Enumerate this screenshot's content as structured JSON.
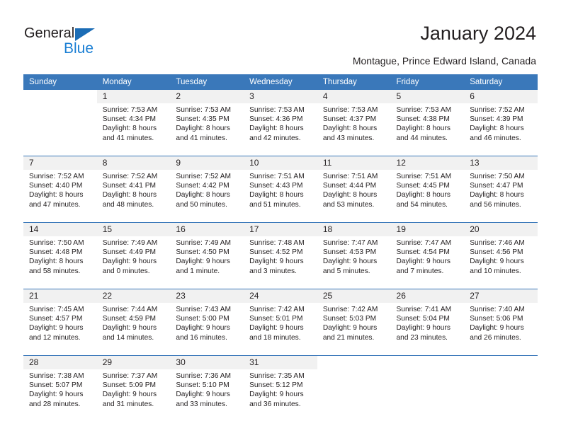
{
  "logo": {
    "word_general": "General",
    "word_blue": "Blue",
    "triangle_color": "#1b6cb5",
    "blue_text_color": "#1b7fd4"
  },
  "header": {
    "title": "January 2024",
    "subtitle": "Montague, Prince Edward Island, Canada"
  },
  "calendar": {
    "accent_color": "#3a78ba",
    "daynum_bg": "#f1f1f1",
    "weekday_headers": [
      "Sunday",
      "Monday",
      "Tuesday",
      "Wednesday",
      "Thursday",
      "Friday",
      "Saturday"
    ],
    "weeks": [
      {
        "days": [
          {
            "num": "",
            "sunrise": "",
            "sunset": "",
            "daylight_1": "",
            "daylight_2": ""
          },
          {
            "num": "1",
            "sunrise": "Sunrise: 7:53 AM",
            "sunset": "Sunset: 4:34 PM",
            "daylight_1": "Daylight: 8 hours",
            "daylight_2": "and 41 minutes."
          },
          {
            "num": "2",
            "sunrise": "Sunrise: 7:53 AM",
            "sunset": "Sunset: 4:35 PM",
            "daylight_1": "Daylight: 8 hours",
            "daylight_2": "and 41 minutes."
          },
          {
            "num": "3",
            "sunrise": "Sunrise: 7:53 AM",
            "sunset": "Sunset: 4:36 PM",
            "daylight_1": "Daylight: 8 hours",
            "daylight_2": "and 42 minutes."
          },
          {
            "num": "4",
            "sunrise": "Sunrise: 7:53 AM",
            "sunset": "Sunset: 4:37 PM",
            "daylight_1": "Daylight: 8 hours",
            "daylight_2": "and 43 minutes."
          },
          {
            "num": "5",
            "sunrise": "Sunrise: 7:53 AM",
            "sunset": "Sunset: 4:38 PM",
            "daylight_1": "Daylight: 8 hours",
            "daylight_2": "and 44 minutes."
          },
          {
            "num": "6",
            "sunrise": "Sunrise: 7:52 AM",
            "sunset": "Sunset: 4:39 PM",
            "daylight_1": "Daylight: 8 hours",
            "daylight_2": "and 46 minutes."
          }
        ]
      },
      {
        "days": [
          {
            "num": "7",
            "sunrise": "Sunrise: 7:52 AM",
            "sunset": "Sunset: 4:40 PM",
            "daylight_1": "Daylight: 8 hours",
            "daylight_2": "and 47 minutes."
          },
          {
            "num": "8",
            "sunrise": "Sunrise: 7:52 AM",
            "sunset": "Sunset: 4:41 PM",
            "daylight_1": "Daylight: 8 hours",
            "daylight_2": "and 48 minutes."
          },
          {
            "num": "9",
            "sunrise": "Sunrise: 7:52 AM",
            "sunset": "Sunset: 4:42 PM",
            "daylight_1": "Daylight: 8 hours",
            "daylight_2": "and 50 minutes."
          },
          {
            "num": "10",
            "sunrise": "Sunrise: 7:51 AM",
            "sunset": "Sunset: 4:43 PM",
            "daylight_1": "Daylight: 8 hours",
            "daylight_2": "and 51 minutes."
          },
          {
            "num": "11",
            "sunrise": "Sunrise: 7:51 AM",
            "sunset": "Sunset: 4:44 PM",
            "daylight_1": "Daylight: 8 hours",
            "daylight_2": "and 53 minutes."
          },
          {
            "num": "12",
            "sunrise": "Sunrise: 7:51 AM",
            "sunset": "Sunset: 4:45 PM",
            "daylight_1": "Daylight: 8 hours",
            "daylight_2": "and 54 minutes."
          },
          {
            "num": "13",
            "sunrise": "Sunrise: 7:50 AM",
            "sunset": "Sunset: 4:47 PM",
            "daylight_1": "Daylight: 8 hours",
            "daylight_2": "and 56 minutes."
          }
        ]
      },
      {
        "days": [
          {
            "num": "14",
            "sunrise": "Sunrise: 7:50 AM",
            "sunset": "Sunset: 4:48 PM",
            "daylight_1": "Daylight: 8 hours",
            "daylight_2": "and 58 minutes."
          },
          {
            "num": "15",
            "sunrise": "Sunrise: 7:49 AM",
            "sunset": "Sunset: 4:49 PM",
            "daylight_1": "Daylight: 9 hours",
            "daylight_2": "and 0 minutes."
          },
          {
            "num": "16",
            "sunrise": "Sunrise: 7:49 AM",
            "sunset": "Sunset: 4:50 PM",
            "daylight_1": "Daylight: 9 hours",
            "daylight_2": "and 1 minute."
          },
          {
            "num": "17",
            "sunrise": "Sunrise: 7:48 AM",
            "sunset": "Sunset: 4:52 PM",
            "daylight_1": "Daylight: 9 hours",
            "daylight_2": "and 3 minutes."
          },
          {
            "num": "18",
            "sunrise": "Sunrise: 7:47 AM",
            "sunset": "Sunset: 4:53 PM",
            "daylight_1": "Daylight: 9 hours",
            "daylight_2": "and 5 minutes."
          },
          {
            "num": "19",
            "sunrise": "Sunrise: 7:47 AM",
            "sunset": "Sunset: 4:54 PM",
            "daylight_1": "Daylight: 9 hours",
            "daylight_2": "and 7 minutes."
          },
          {
            "num": "20",
            "sunrise": "Sunrise: 7:46 AM",
            "sunset": "Sunset: 4:56 PM",
            "daylight_1": "Daylight: 9 hours",
            "daylight_2": "and 10 minutes."
          }
        ]
      },
      {
        "days": [
          {
            "num": "21",
            "sunrise": "Sunrise: 7:45 AM",
            "sunset": "Sunset: 4:57 PM",
            "daylight_1": "Daylight: 9 hours",
            "daylight_2": "and 12 minutes."
          },
          {
            "num": "22",
            "sunrise": "Sunrise: 7:44 AM",
            "sunset": "Sunset: 4:59 PM",
            "daylight_1": "Daylight: 9 hours",
            "daylight_2": "and 14 minutes."
          },
          {
            "num": "23",
            "sunrise": "Sunrise: 7:43 AM",
            "sunset": "Sunset: 5:00 PM",
            "daylight_1": "Daylight: 9 hours",
            "daylight_2": "and 16 minutes."
          },
          {
            "num": "24",
            "sunrise": "Sunrise: 7:42 AM",
            "sunset": "Sunset: 5:01 PM",
            "daylight_1": "Daylight: 9 hours",
            "daylight_2": "and 18 minutes."
          },
          {
            "num": "25",
            "sunrise": "Sunrise: 7:42 AM",
            "sunset": "Sunset: 5:03 PM",
            "daylight_1": "Daylight: 9 hours",
            "daylight_2": "and 21 minutes."
          },
          {
            "num": "26",
            "sunrise": "Sunrise: 7:41 AM",
            "sunset": "Sunset: 5:04 PM",
            "daylight_1": "Daylight: 9 hours",
            "daylight_2": "and 23 minutes."
          },
          {
            "num": "27",
            "sunrise": "Sunrise: 7:40 AM",
            "sunset": "Sunset: 5:06 PM",
            "daylight_1": "Daylight: 9 hours",
            "daylight_2": "and 26 minutes."
          }
        ]
      },
      {
        "days": [
          {
            "num": "28",
            "sunrise": "Sunrise: 7:38 AM",
            "sunset": "Sunset: 5:07 PM",
            "daylight_1": "Daylight: 9 hours",
            "daylight_2": "and 28 minutes."
          },
          {
            "num": "29",
            "sunrise": "Sunrise: 7:37 AM",
            "sunset": "Sunset: 5:09 PM",
            "daylight_1": "Daylight: 9 hours",
            "daylight_2": "and 31 minutes."
          },
          {
            "num": "30",
            "sunrise": "Sunrise: 7:36 AM",
            "sunset": "Sunset: 5:10 PM",
            "daylight_1": "Daylight: 9 hours",
            "daylight_2": "and 33 minutes."
          },
          {
            "num": "31",
            "sunrise": "Sunrise: 7:35 AM",
            "sunset": "Sunset: 5:12 PM",
            "daylight_1": "Daylight: 9 hours",
            "daylight_2": "and 36 minutes."
          },
          {
            "num": "",
            "sunrise": "",
            "sunset": "",
            "daylight_1": "",
            "daylight_2": ""
          },
          {
            "num": "",
            "sunrise": "",
            "sunset": "",
            "daylight_1": "",
            "daylight_2": ""
          },
          {
            "num": "",
            "sunrise": "",
            "sunset": "",
            "daylight_1": "",
            "daylight_2": ""
          }
        ]
      }
    ]
  }
}
